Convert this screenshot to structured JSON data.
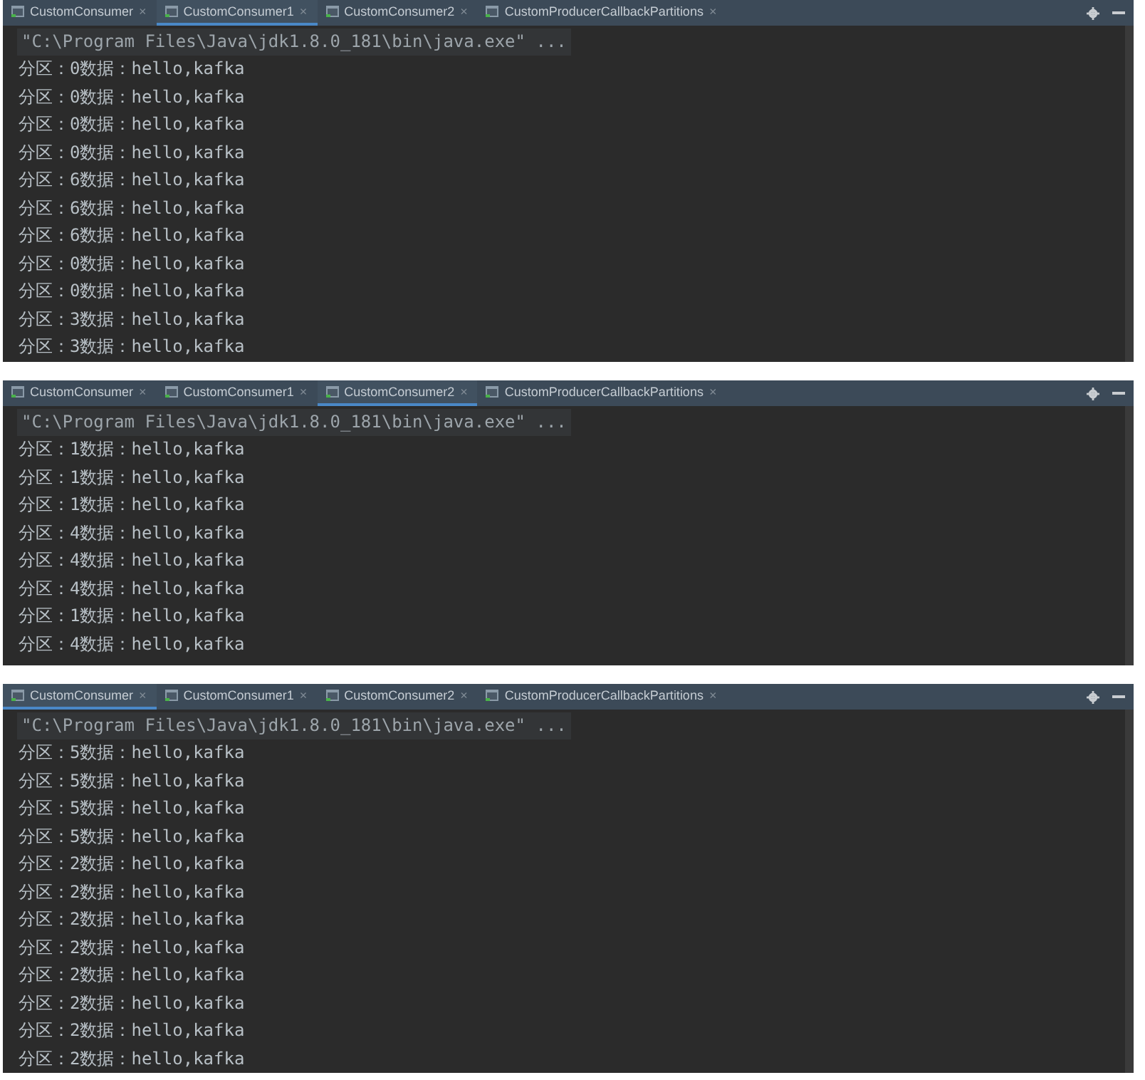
{
  "panels": [
    {
      "tabs": [
        {
          "label": "CustomConsumer",
          "close": "×",
          "selected": false
        },
        {
          "label": "CustomConsumer1",
          "close": "×",
          "selected": true
        },
        {
          "label": "CustomConsumer2",
          "close": "×",
          "selected": false
        },
        {
          "label": "CustomProducerCallbackPartitions",
          "close": "×",
          "selected": false
        }
      ],
      "command": "\"C:\\Program Files\\Java\\jdk1.8.0_181\\bin\\java.exe\" ...",
      "lines": [
        "分区：0数据：hello,kafka",
        "分区：0数据：hello,kafka",
        "分区：0数据：hello,kafka",
        "分区：0数据：hello,kafka",
        "分区：6数据：hello,kafka",
        "分区：6数据：hello,kafka",
        "分区：6数据：hello,kafka",
        "分区：0数据：hello,kafka",
        "分区：0数据：hello,kafka",
        "分区：3数据：hello,kafka",
        "分区：3数据：hello,kafka"
      ]
    },
    {
      "tabs": [
        {
          "label": "CustomConsumer",
          "close": "×",
          "selected": false
        },
        {
          "label": "CustomConsumer1",
          "close": "×",
          "selected": false
        },
        {
          "label": "CustomConsumer2",
          "close": "×",
          "selected": true
        },
        {
          "label": "CustomProducerCallbackPartitions",
          "close": "×",
          "selected": false
        }
      ],
      "command": "\"C:\\Program Files\\Java\\jdk1.8.0_181\\bin\\java.exe\" ...",
      "lines": [
        "分区：1数据：hello,kafka",
        "分区：1数据：hello,kafka",
        "分区：1数据：hello,kafka",
        "分区：4数据：hello,kafka",
        "分区：4数据：hello,kafka",
        "分区：4数据：hello,kafka",
        "分区：1数据：hello,kafka",
        "分区：4数据：hello,kafka"
      ]
    },
    {
      "tabs": [
        {
          "label": "CustomConsumer",
          "close": "×",
          "selected": true
        },
        {
          "label": "CustomConsumer1",
          "close": "×",
          "selected": false
        },
        {
          "label": "CustomConsumer2",
          "close": "×",
          "selected": false
        },
        {
          "label": "CustomProducerCallbackPartitions",
          "close": "×",
          "selected": false
        }
      ],
      "command": "\"C:\\Program Files\\Java\\jdk1.8.0_181\\bin\\java.exe\" ...",
      "lines": [
        "分区：5数据：hello,kafka",
        "分区：5数据：hello,kafka",
        "分区：5数据：hello,kafka",
        "分区：5数据：hello,kafka",
        "分区：2数据：hello,kafka",
        "分区：2数据：hello,kafka",
        "分区：2数据：hello,kafka",
        "分区：2数据：hello,kafka",
        "分区：2数据：hello,kafka",
        "分区：2数据：hello,kafka",
        "分区：2数据：hello,kafka",
        "分区：2数据：hello,kafka"
      ]
    }
  ]
}
